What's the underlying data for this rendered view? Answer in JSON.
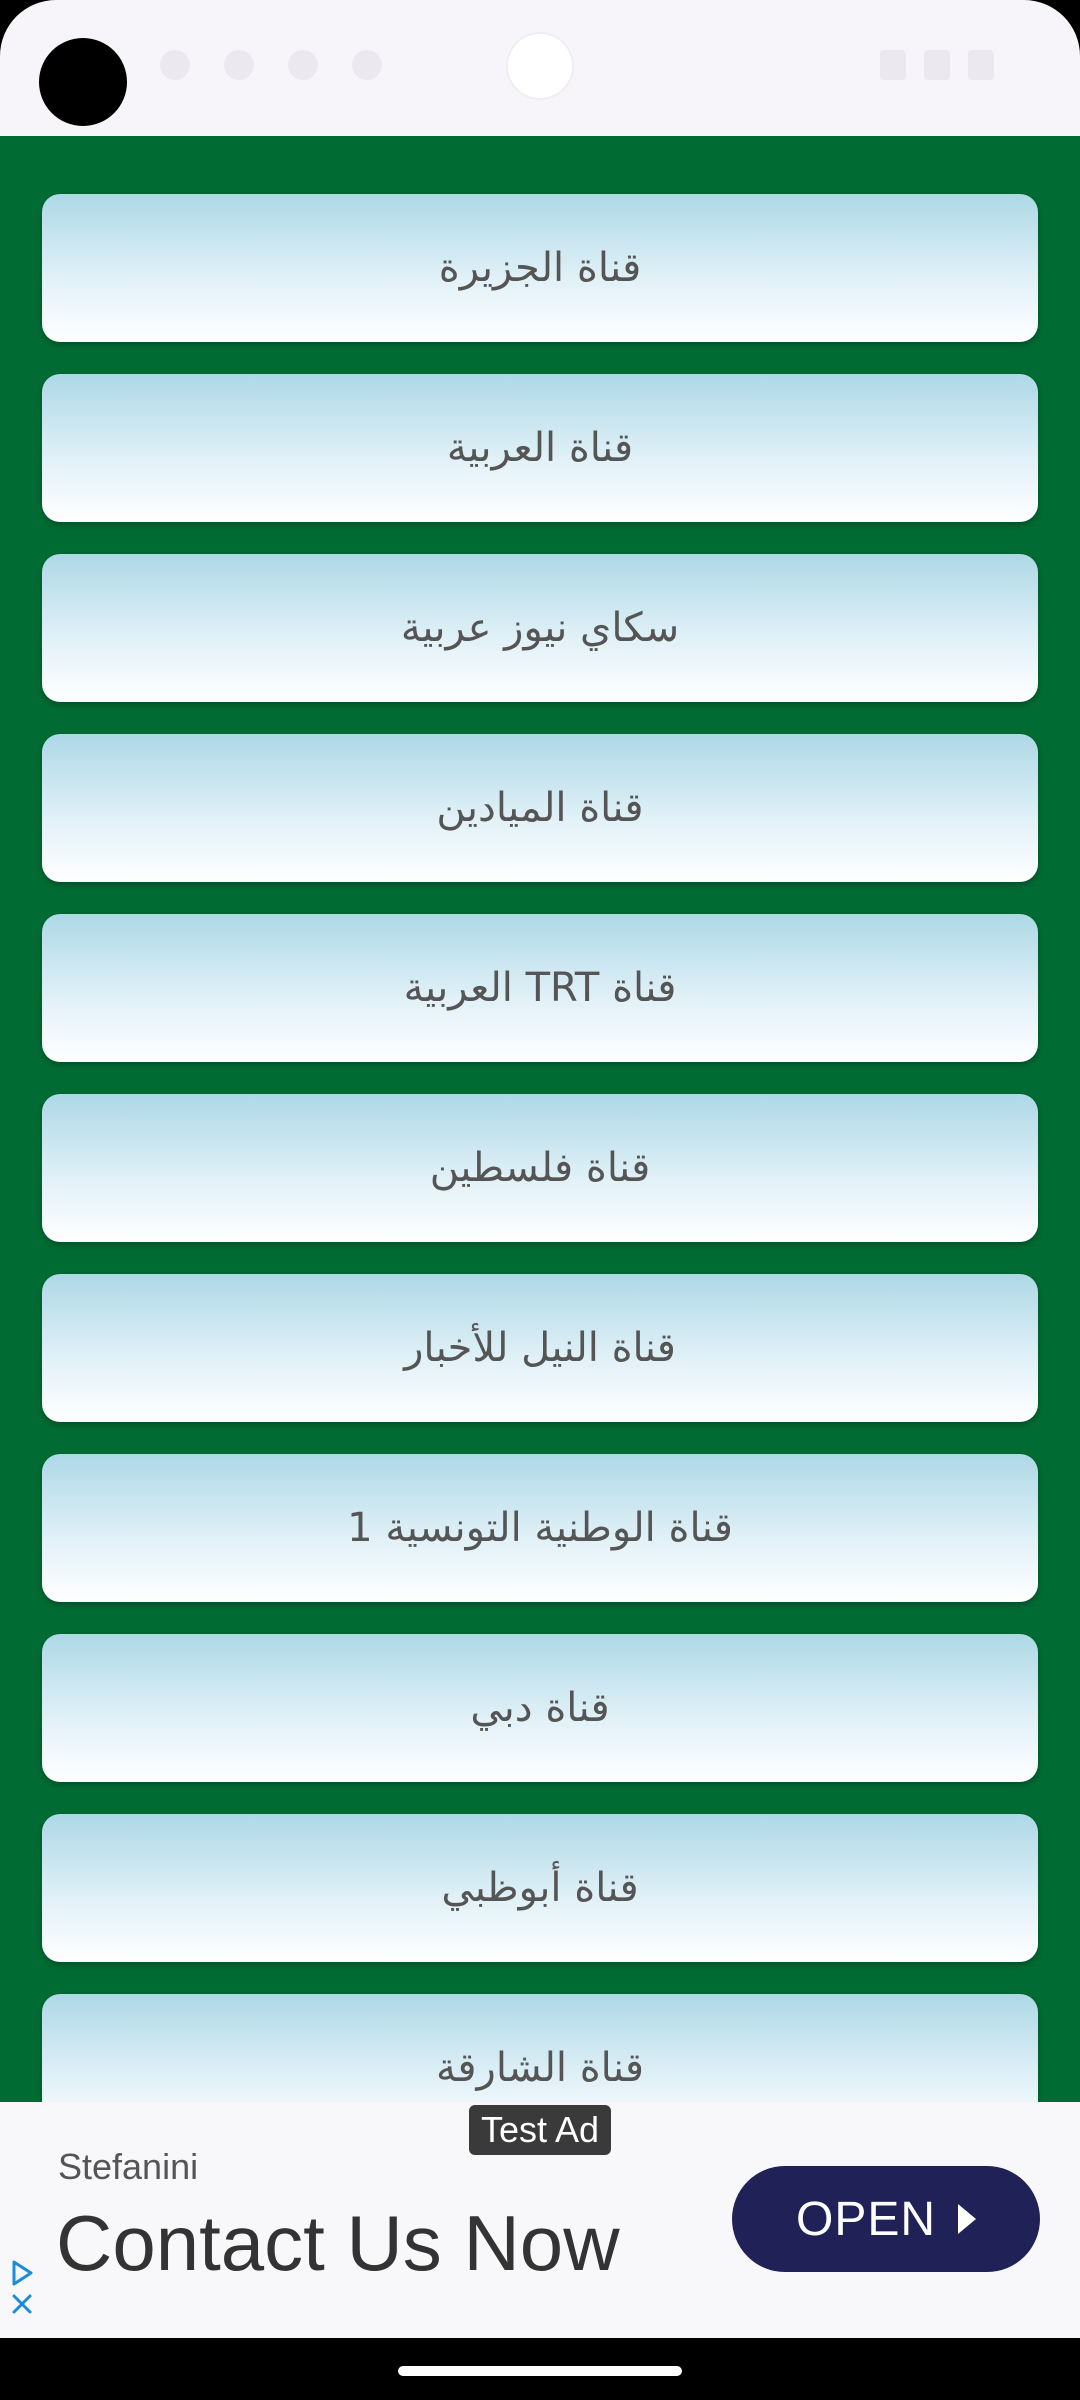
{
  "channels": [
    {
      "label": "قناة الجزيرة"
    },
    {
      "label": "قناة العربية"
    },
    {
      "label": "سكاي نيوز عربية"
    },
    {
      "label": "قناة الميادين"
    },
    {
      "label": "قناة TRT العربية"
    },
    {
      "label": "قناة فلسطين"
    },
    {
      "label": "قناة النيل للأخبار"
    },
    {
      "label": "قناة الوطنية التونسية 1"
    },
    {
      "label": "قناة دبي"
    },
    {
      "label": "قناة أبوظبي"
    },
    {
      "label": "قناة الشارقة"
    }
  ],
  "ad": {
    "badge": "Test Ad",
    "advertiser": "Stefanini",
    "headline": "Contact Us Now",
    "cta_label": "OPEN"
  },
  "icons": {
    "camera": "camera-cutout",
    "ad_choices": "ad-choices-icon",
    "ad_close": "close-icon",
    "cta_arrow": "play-arrow-icon"
  },
  "colors": {
    "background": "#006b33",
    "button_gradient_top": "#add8e6",
    "button_gradient_bottom": "#ffffff",
    "cta_background": "#1f2157"
  }
}
